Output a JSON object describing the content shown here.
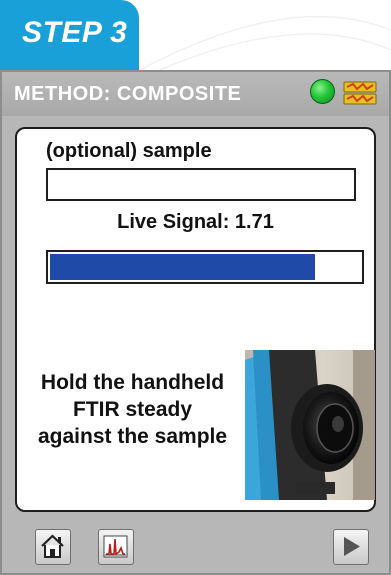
{
  "step": {
    "label": "STEP 3"
  },
  "header": {
    "title": "METHOD: COMPOSITE",
    "status_color": "#22c53a",
    "status_icon": "status-indicator-icon",
    "battery_icon": "battery-icon"
  },
  "main": {
    "sample_label": "(optional) sample",
    "sample_value": "",
    "live_signal_text": "Live Signal: 1.71",
    "signal_level_fraction": 0.855,
    "signal_bar_color": "#1f4aa8",
    "instruction_lines": [
      "Hold the handheld",
      "FTIR steady",
      "against the sample"
    ],
    "photo_icon": "handheld-ftir-photo"
  },
  "footer": {
    "home_icon": "home-icon",
    "spectrum_icon": "spectrum-icon",
    "next_icon": "play-arrow-icon"
  },
  "colors": {
    "step_tab": "#1aa0d8",
    "device_frame": "#b7b7b7",
    "header_text": "#ffffff"
  }
}
